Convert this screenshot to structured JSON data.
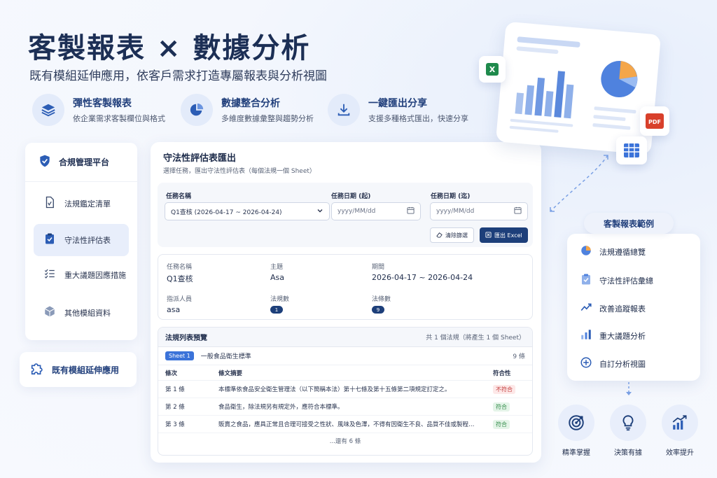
{
  "hero": {
    "title": "客製報表 × 數據分析",
    "subtitle": "既有模組延伸應用，依客戶需求打造專屬報表與分析視圖"
  },
  "features": [
    {
      "title": "彈性客製報表",
      "desc": "依企業需求客製欄位與格式",
      "icon": "layers-icon"
    },
    {
      "title": "數據整合分析",
      "desc": "多維度數據彙整與趨勢分析",
      "icon": "pie-chart-icon"
    },
    {
      "title": "一鍵匯出分享",
      "desc": "支援多種格式匯出，快速分享",
      "icon": "download-icon"
    }
  ],
  "sidebar": {
    "header": "合規管理平台",
    "items": [
      {
        "label": "法規鑑定清單",
        "icon": "document-icon",
        "active": false
      },
      {
        "label": "守法性評估表",
        "icon": "clipboard-check-icon",
        "active": true
      },
      {
        "label": "重大議題因應措施",
        "icon": "checklist-icon",
        "active": false
      },
      {
        "label": "其他模組資料",
        "icon": "box-icon",
        "active": false
      }
    ],
    "extension": "既有模組延伸應用"
  },
  "panel": {
    "title": "守法性評估表匯出",
    "subtitle": "選擇任務，匯出守法性評估表（每個法規一個 Sheet）",
    "filters": {
      "task_label": "任務名稱",
      "task_value": "Q1查核 (2026-04-17 ~ 2026-04-24)",
      "date_from_label": "任務日期 (起)",
      "date_to_label": "任務日期 (迄)",
      "date_placeholder": "yyyy/MM/dd",
      "clear_button": "清除篩選",
      "export_button": "匯出 Excel"
    },
    "info": {
      "task_name_label": "任務名稱",
      "task_name": "Q1查核",
      "subject_label": "主題",
      "subject": "Asa",
      "period_label": "期間",
      "period": "2026-04-17 ~ 2026-04-24",
      "assignee_label": "指派人員",
      "assignee": "asa",
      "law_count_label": "法規數",
      "law_count": "1",
      "article_count_label": "法條數",
      "article_count": "9"
    },
    "list": {
      "title": "法規列表預覽",
      "summary": "共 1 個法規（將產生 1 個 Sheet）",
      "sheet_tag": "Sheet 1",
      "sheet_name": "一般食品衛生標準",
      "sheet_count": "9 條",
      "headers": [
        "條次",
        "條文摘要",
        "符合性"
      ],
      "rows": [
        {
          "no": "第 1 條",
          "summary": "本標準依食品安全衛生管理法（以下簡稱本法）第十七條及第十五條第二項規定訂定之。",
          "status": "不符合",
          "ok": false
        },
        {
          "no": "第 2 條",
          "summary": "食品衛生，除法規另有規定外，應符合本標準。",
          "status": "符合",
          "ok": true
        },
        {
          "no": "第 3 條",
          "summary": "販賣之食品，應具正常且合理可接受之性狀、風味及色澤，不得有因衛生不良、品質不佳或製程…",
          "status": "符合",
          "ok": true
        }
      ],
      "more": "...還有 6 條"
    }
  },
  "file_badges": [
    "X",
    "PDF"
  ],
  "examples": {
    "title": "客製報表範例",
    "items": [
      {
        "label": "法規遵循總覽",
        "icon": "pie-chart-icon"
      },
      {
        "label": "守法性評估彙總",
        "icon": "clipboard-check-icon"
      },
      {
        "label": "改善追蹤報表",
        "icon": "trend-line-icon"
      },
      {
        "label": "重大議題分析",
        "icon": "bar-chart-icon"
      },
      {
        "label": "自訂分析視圖",
        "icon": "plus-circle-icon"
      }
    ]
  },
  "benefits": [
    {
      "label": "精準掌握",
      "icon": "target-icon"
    },
    {
      "label": "決策有據",
      "icon": "lightbulb-icon"
    },
    {
      "label": "效率提升",
      "icon": "growth-chart-icon"
    }
  ],
  "colors": {
    "primary": "#1d3f7a",
    "accent": "#3b73d9",
    "danger": "#c23a3a",
    "success": "#2f8a47"
  }
}
